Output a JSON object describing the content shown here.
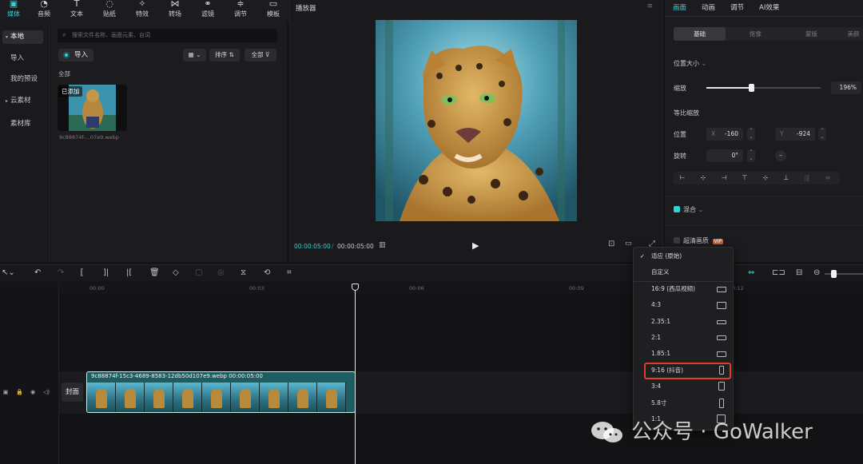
{
  "toolbar": {
    "items": [
      {
        "label": "媒体",
        "icon": "media-icon"
      },
      {
        "label": "音频",
        "icon": "audio-icon"
      },
      {
        "label": "文本",
        "icon": "text-icon"
      },
      {
        "label": "贴纸",
        "icon": "sticker-icon"
      },
      {
        "label": "特效",
        "icon": "effects-icon"
      },
      {
        "label": "转场",
        "icon": "transition-icon"
      },
      {
        "label": "滤镜",
        "icon": "filter-icon"
      },
      {
        "label": "调节",
        "icon": "adjust-icon"
      },
      {
        "label": "模板",
        "icon": "template-icon"
      }
    ],
    "active_index": 0
  },
  "leftnav": {
    "items": [
      "本地",
      "导入",
      "我的预设",
      "云素材",
      "素材库"
    ],
    "selected": "本地"
  },
  "media": {
    "search_placeholder": "搜索文件名称、画面元素、台词",
    "import_label": "导入",
    "sort_label": "排序",
    "filter_label": "全部",
    "section_label": "全部",
    "card_badge": "已添加",
    "card_filename": "9c88874f-...07e9.webp"
  },
  "player": {
    "title": "播放器",
    "time_current": "00:00:05:00",
    "time_total": "00:00:05:00"
  },
  "inspector": {
    "tabs": [
      "画面",
      "动画",
      "调节",
      "AI效果"
    ],
    "active_tab": "画面",
    "subtabs": [
      "基础",
      "抠像",
      "蒙版",
      "美颜"
    ],
    "active_subtab": "基础",
    "section_position_size": "位置大小",
    "scale_label": "缩放",
    "scale_value": "196%",
    "scale_fraction": 0.39,
    "uniform_scale_label": "等比缩放",
    "position_label": "位置",
    "pos_x_prefix": "X",
    "pos_x": "-160",
    "pos_y_prefix": "Y",
    "pos_y": "-924",
    "rotate_label": "旋转",
    "rotate_value": "0°",
    "blend_label": "混合",
    "hd_label": "超清画质",
    "vip_badge": "VIP"
  },
  "timeline": {
    "ticks": [
      "00:00",
      "00:03",
      "00:06",
      "00:09",
      "00:12"
    ],
    "cover_label": "封面",
    "clip_label": "9c88874f-15c3-4689-8583-12db50d107e9.webp   00:00:05:00"
  },
  "ratio_menu": {
    "options": [
      {
        "label": "适应 (原始)",
        "checked": true
      },
      {
        "label": "自定义",
        "checked": false
      },
      {
        "label": "16:9 (西瓜视频)",
        "checked": false
      },
      {
        "label": "4:3",
        "checked": false
      },
      {
        "label": "2.35:1",
        "checked": false
      },
      {
        "label": "2:1",
        "checked": false
      },
      {
        "label": "1.85:1",
        "checked": false
      },
      {
        "label": "9:16 (抖音)",
        "checked": false
      },
      {
        "label": "3:4",
        "checked": false
      },
      {
        "label": "5.8寸",
        "checked": false
      },
      {
        "label": "1:1",
        "checked": false
      }
    ],
    "highlighted": "9:16 (抖音)"
  },
  "watermark": {
    "text": "公众号 · GoWalker"
  },
  "colors": {
    "accent": "#2cd4d9",
    "highlight": "#e53a2f",
    "panel": "#1c1c1f"
  }
}
